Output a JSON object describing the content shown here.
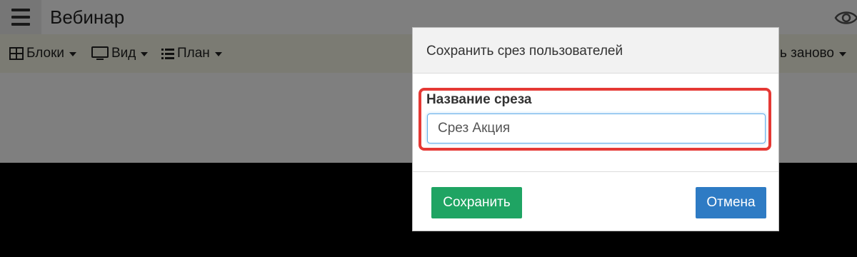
{
  "app": {
    "title": "Вебинар",
    "toolbar": {
      "blocks_label": "Блоки",
      "view_label": "Вид",
      "plan_label": "План",
      "restart_label": "ь заново"
    }
  },
  "modal": {
    "title": "Сохранить срез пользователей",
    "field_label": "Название среза",
    "field_value": "Срез Акция",
    "save_label": "Сохранить",
    "cancel_label": "Отмена"
  },
  "colors": {
    "save_button": "#1fa463",
    "cancel_button": "#2e7bc4",
    "highlight": "#e53935",
    "toolbar_bg": "#f6f7e6"
  }
}
